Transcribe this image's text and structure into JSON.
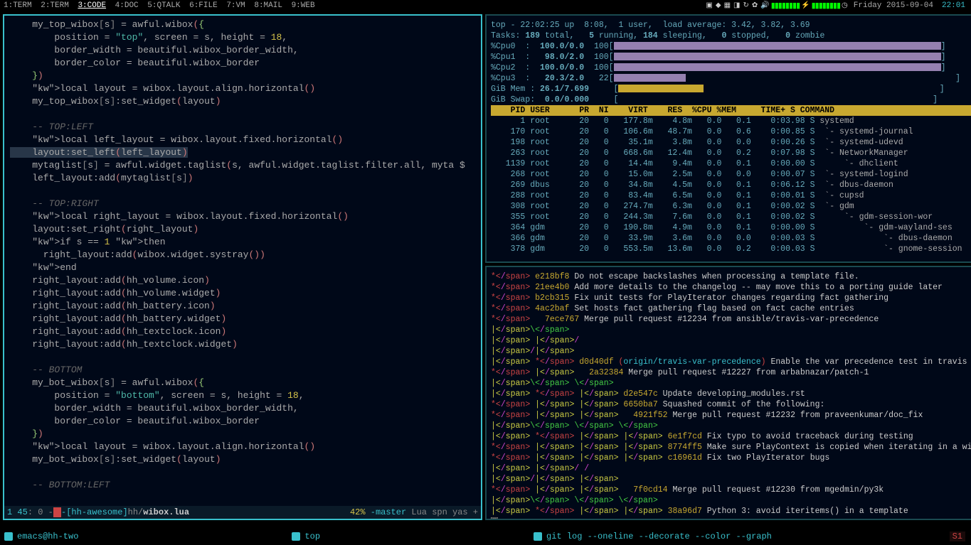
{
  "topbar": {
    "tags": [
      "1:TERM",
      "2:TERM",
      "3:CODE",
      "4:DOC",
      "5:QTALK",
      "6:FILE",
      "7:VM",
      "8:MAIL",
      "9:WEB"
    ],
    "active_tag": 2,
    "date": "Friday 2015-09-04",
    "time": "22:01"
  },
  "code": {
    "lines": [
      {
        "t": "    my_top_wibox[s] = awful.wibox({",
        "cls": [
          "var",
          "bracket",
          "var",
          "bracket",
          "op",
          "fn",
          "paren",
          "paren2"
        ]
      },
      {
        "t": "        position = \"top\", screen = s, height = 18,",
        "cls": []
      },
      {
        "t": "        border_width = beautiful.wibox_border_width,",
        "cls": []
      },
      {
        "t": "        border_color = beautiful.wibox_border",
        "cls": []
      },
      {
        "t": "    })",
        "cls": []
      },
      {
        "t": "    local layout = wibox.layout.align.horizontal()",
        "cls": []
      },
      {
        "t": "    my_top_wibox[s]:set_widget(layout)",
        "cls": []
      },
      {
        "t": "",
        "cls": []
      },
      {
        "t": "    -- TOP:LEFT",
        "comment": true
      },
      {
        "t": "    local left_layout = wibox.layout.fixed.horizontal()",
        "cls": []
      },
      {
        "t": "    layout:set_left(left_layout)",
        "hl": true
      },
      {
        "t": "    mytaglist[s] = awful.widget.taglist(s, awful.widget.taglist.filter.all, myta $",
        "cls": []
      },
      {
        "t": "    left_layout:add(mytaglist[s])",
        "cls": []
      },
      {
        "t": "",
        "cls": []
      },
      {
        "t": "    -- TOP:RIGHT",
        "comment": true
      },
      {
        "t": "    local right_layout = wibox.layout.fixed.horizontal()",
        "cls": []
      },
      {
        "t": "    layout:set_right(right_layout)",
        "cls": []
      },
      {
        "t": "    if s == 1 then",
        "cls": []
      },
      {
        "t": "      right_layout:add(wibox.widget.systray())",
        "cls": []
      },
      {
        "t": "    end",
        "cls": []
      },
      {
        "t": "    right_layout:add(hh_volume.icon)",
        "cls": []
      },
      {
        "t": "    right_layout:add(hh_volume.widget)",
        "cls": []
      },
      {
        "t": "    right_layout:add(hh_battery.icon)",
        "cls": []
      },
      {
        "t": "    right_layout:add(hh_battery.widget)",
        "cls": []
      },
      {
        "t": "    right_layout:add(hh_textclock.icon)",
        "cls": []
      },
      {
        "t": "    right_layout:add(hh_textclock.widget)",
        "cls": []
      },
      {
        "t": "",
        "cls": []
      },
      {
        "t": "    -- BOTTOM",
        "comment": true
      },
      {
        "t": "    my_bot_wibox[s] = awful.wibox({",
        "cls": []
      },
      {
        "t": "        position = \"bottom\", screen = s, height = 18,",
        "cls": []
      },
      {
        "t": "        border_width = beautiful.wibox_border_width,",
        "cls": []
      },
      {
        "t": "        border_color = beautiful.wibox_border",
        "cls": []
      },
      {
        "t": "    })",
        "cls": []
      },
      {
        "t": "    local layout = wibox.layout.align.horizontal()",
        "cls": []
      },
      {
        "t": "    my_bot_wibox[s]:set_widget(layout)",
        "cls": []
      },
      {
        "t": "",
        "cls": []
      },
      {
        "t": "    -- BOTTOM:LEFT",
        "comment": true
      }
    ],
    "modeline": {
      "line_num": "1 45",
      "col": ": 0 -",
      "mod": "M",
      "proj": "-[hh-awesome]",
      "path": "hh/",
      "file": "wibox.lua",
      "percent": "42%",
      "vcs": "-master",
      "mode": "Lua",
      "minor": "spn yas +"
    }
  },
  "top": {
    "summary1": "top - 22:02:25 up  8:08,  1 user,  load average: 3.42, 3.82, 3.69",
    "summary2": "Tasks: 189 total,   5 running, 184 sleeping,   0 stopped,   0 zombie",
    "cpus": [
      {
        "label": "%Cpu0  :",
        "val": "100.0/0.0",
        "pct": "100",
        "bar": 100
      },
      {
        "label": "%Cpu1  :",
        "val": " 98.0/2.0",
        "pct": "100",
        "bar": 100
      },
      {
        "label": "%Cpu2  :",
        "val": "100.0/0.0",
        "pct": "100",
        "bar": 100
      },
      {
        "label": "%Cpu3  :",
        "val": " 20.3/2.0",
        "pct": " 22",
        "bar": 22
      }
    ],
    "mem": {
      "label": "GiB Mem :",
      "val": "26.1/7.699",
      "bar": 26
    },
    "swap": {
      "label": "GiB Swap:",
      "val": " 0.0/0.000",
      "bar": 0
    },
    "header": "    PID USER      PR  NI    VIRT    RES  %CPU %MEM     TIME+ S COMMAND",
    "procs": [
      {
        "pid": "      1",
        "user": "root",
        "pr": "20",
        "ni": "0",
        "virt": "177.8m",
        "res": "4.8m",
        "cpu": "0.0",
        "mem": "0.1",
        "time": "0:03.98",
        "s": "S",
        "cmd": "systemd"
      },
      {
        "pid": "    170",
        "user": "root",
        "pr": "20",
        "ni": "0",
        "virt": "106.6m",
        "res": "48.7m",
        "cpu": "0.0",
        "mem": "0.6",
        "time": "0:00.85",
        "s": "S",
        "cmd": " `- systemd-journal"
      },
      {
        "pid": "    198",
        "user": "root",
        "pr": "20",
        "ni": "0",
        "virt": " 35.1m",
        "res": "3.8m",
        "cpu": "0.0",
        "mem": "0.0",
        "time": "0:00.26",
        "s": "S",
        "cmd": " `- systemd-udevd"
      },
      {
        "pid": "    263",
        "user": "root",
        "pr": "20",
        "ni": "0",
        "virt": "668.6m",
        "res": "12.4m",
        "cpu": "0.0",
        "mem": "0.2",
        "time": "0:07.98",
        "s": "S",
        "cmd": " `- NetworkManager"
      },
      {
        "pid": "   1139",
        "user": "root",
        "pr": "20",
        "ni": "0",
        "virt": " 14.4m",
        "res": "9.4m",
        "cpu": "0.0",
        "mem": "0.1",
        "time": "0:00.00",
        "s": "S",
        "cmd": "     `- dhclient"
      },
      {
        "pid": "    268",
        "user": "root",
        "pr": "20",
        "ni": "0",
        "virt": " 15.0m",
        "res": "2.5m",
        "cpu": "0.0",
        "mem": "0.0",
        "time": "0:00.07",
        "s": "S",
        "cmd": " `- systemd-logind"
      },
      {
        "pid": "    269",
        "user": "dbus",
        "pr": "20",
        "ni": "0",
        "virt": " 34.8m",
        "res": "4.5m",
        "cpu": "0.0",
        "mem": "0.1",
        "time": "0:06.12",
        "s": "S",
        "cmd": " `- dbus-daemon"
      },
      {
        "pid": "    288",
        "user": "root",
        "pr": "20",
        "ni": "0",
        "virt": " 83.4m",
        "res": "6.5m",
        "cpu": "0.0",
        "mem": "0.1",
        "time": "0:00.01",
        "s": "S",
        "cmd": " `- cupsd"
      },
      {
        "pid": "    308",
        "user": "root",
        "pr": "20",
        "ni": "0",
        "virt": "274.7m",
        "res": "6.3m",
        "cpu": "0.0",
        "mem": "0.1",
        "time": "0:00.02",
        "s": "S",
        "cmd": " `- gdm"
      },
      {
        "pid": "    355",
        "user": "root",
        "pr": "20",
        "ni": "0",
        "virt": "244.3m",
        "res": "7.6m",
        "cpu": "0.0",
        "mem": "0.1",
        "time": "0:00.02",
        "s": "S",
        "cmd": "     `- gdm-session-wor"
      },
      {
        "pid": "    364",
        "user": "gdm",
        "pr": "20",
        "ni": "0",
        "virt": "190.8m",
        "res": "4.9m",
        "cpu": "0.0",
        "mem": "0.1",
        "time": "0:00.00",
        "s": "S",
        "cmd": "         `- gdm-wayland-ses"
      },
      {
        "pid": "    366",
        "user": "gdm",
        "pr": "20",
        "ni": "0",
        "virt": " 33.9m",
        "res": "3.6m",
        "cpu": "0.0",
        "mem": "0.0",
        "time": "0:00.03",
        "s": "S",
        "cmd": "             `- dbus-daemon"
      },
      {
        "pid": "    378",
        "user": "gdm",
        "pr": "20",
        "ni": "0",
        "virt": "553.5m",
        "res": "13.6m",
        "cpu": "0.0",
        "mem": "0.2",
        "time": "0:00.03",
        "s": "S",
        "cmd": "             `- gnome-session"
      }
    ]
  },
  "git": {
    "lines": [
      {
        "g": "* ",
        "h": "e218bf8",
        "m": "Do not escape backslashes when processing a template file."
      },
      {
        "g": "* ",
        "h": "21ee4b0",
        "m": "Add more details to the changelog -- may move this to a porting guide later"
      },
      {
        "g": "* ",
        "h": "b2cb315",
        "m": "Fix unit tests for PlayIterator changes regarding fact gathering"
      },
      {
        "g": "* ",
        "h": "4ac2baf",
        "m": "Set hosts fact gathering flag based on fact cache entries"
      },
      {
        "g": "*   ",
        "h": "7ece767",
        "m": "Merge pull request #12234 from ansible/travis-var-precedence"
      },
      {
        "g": "|\\  ",
        "h": "",
        "m": ""
      },
      {
        "g": "| |/",
        "h": "",
        "m": ""
      },
      {
        "g": "|/| ",
        "h": "",
        "m": ""
      },
      {
        "g": "| * ",
        "h": "d0d40df",
        "ref": "(origin/travis-var-precedence)",
        "m": " Enable the var precedence test in travis"
      },
      {
        "g": "* |   ",
        "h": "2a32384",
        "m": "Merge pull request #12227 from arbabnazar/patch-1"
      },
      {
        "g": "|\\ \\  ",
        "h": "",
        "m": ""
      },
      {
        "g": "| * | ",
        "h": "d2e547c",
        "m": "Update developing_modules.rst"
      },
      {
        "g": "* | | ",
        "h": "6650ba7",
        "m": "Squashed commit of the following:"
      },
      {
        "g": "* | |   ",
        "h": "4921f52",
        "m": "Merge pull request #12232 from praveenkumar/doc_fix"
      },
      {
        "g": "|\\ \\ \\  ",
        "h": "",
        "m": ""
      },
      {
        "g": "| * | | ",
        "h": "6e1f7cd",
        "m": "Fix typo to avoid traceback during testing"
      },
      {
        "g": "* | | | ",
        "h": "8774ff5",
        "m": "Make sure PlayContext is copied when iterating in a with_ loop"
      },
      {
        "g": "* | | | ",
        "h": "c16961d",
        "m": "Fix two PlayIterator bugs"
      },
      {
        "g": "| |/ /  ",
        "h": "",
        "m": ""
      },
      {
        "g": "|/| | ",
        "h": "",
        "m": ""
      },
      {
        "g": "* | |   ",
        "h": "7f0cd14",
        "m": "Merge pull request #12230 from mgedmin/py3k"
      },
      {
        "g": "|\\ \\ \\  ",
        "h": "",
        "m": ""
      },
      {
        "g": "| * | | ",
        "h": "38a96d7",
        "m": "Python 3: avoid iteritems() in a template"
      }
    ],
    "cursor": "☐"
  },
  "taskbar": {
    "items": [
      "emacs@hh-two",
      "top",
      "git log --oneline --decorate --color --graph"
    ],
    "badge": "S1"
  }
}
